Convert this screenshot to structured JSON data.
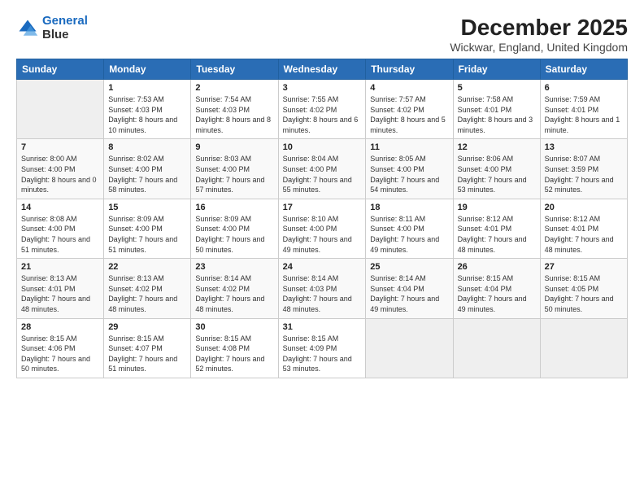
{
  "header": {
    "logo_line1": "General",
    "logo_line2": "Blue",
    "title": "December 2025",
    "subtitle": "Wickwar, England, United Kingdom"
  },
  "columns": [
    "Sunday",
    "Monday",
    "Tuesday",
    "Wednesday",
    "Thursday",
    "Friday",
    "Saturday"
  ],
  "weeks": [
    [
      {
        "day": "",
        "empty": true
      },
      {
        "day": "1",
        "sunrise": "Sunrise: 7:53 AM",
        "sunset": "Sunset: 4:03 PM",
        "daylight": "Daylight: 8 hours and 10 minutes."
      },
      {
        "day": "2",
        "sunrise": "Sunrise: 7:54 AM",
        "sunset": "Sunset: 4:03 PM",
        "daylight": "Daylight: 8 hours and 8 minutes."
      },
      {
        "day": "3",
        "sunrise": "Sunrise: 7:55 AM",
        "sunset": "Sunset: 4:02 PM",
        "daylight": "Daylight: 8 hours and 6 minutes."
      },
      {
        "day": "4",
        "sunrise": "Sunrise: 7:57 AM",
        "sunset": "Sunset: 4:02 PM",
        "daylight": "Daylight: 8 hours and 5 minutes."
      },
      {
        "day": "5",
        "sunrise": "Sunrise: 7:58 AM",
        "sunset": "Sunset: 4:01 PM",
        "daylight": "Daylight: 8 hours and 3 minutes."
      },
      {
        "day": "6",
        "sunrise": "Sunrise: 7:59 AM",
        "sunset": "Sunset: 4:01 PM",
        "daylight": "Daylight: 8 hours and 1 minute."
      }
    ],
    [
      {
        "day": "7",
        "sunrise": "Sunrise: 8:00 AM",
        "sunset": "Sunset: 4:00 PM",
        "daylight": "Daylight: 8 hours and 0 minutes."
      },
      {
        "day": "8",
        "sunrise": "Sunrise: 8:02 AM",
        "sunset": "Sunset: 4:00 PM",
        "daylight": "Daylight: 7 hours and 58 minutes."
      },
      {
        "day": "9",
        "sunrise": "Sunrise: 8:03 AM",
        "sunset": "Sunset: 4:00 PM",
        "daylight": "Daylight: 7 hours and 57 minutes."
      },
      {
        "day": "10",
        "sunrise": "Sunrise: 8:04 AM",
        "sunset": "Sunset: 4:00 PM",
        "daylight": "Daylight: 7 hours and 55 minutes."
      },
      {
        "day": "11",
        "sunrise": "Sunrise: 8:05 AM",
        "sunset": "Sunset: 4:00 PM",
        "daylight": "Daylight: 7 hours and 54 minutes."
      },
      {
        "day": "12",
        "sunrise": "Sunrise: 8:06 AM",
        "sunset": "Sunset: 4:00 PM",
        "daylight": "Daylight: 7 hours and 53 minutes."
      },
      {
        "day": "13",
        "sunrise": "Sunrise: 8:07 AM",
        "sunset": "Sunset: 3:59 PM",
        "daylight": "Daylight: 7 hours and 52 minutes."
      }
    ],
    [
      {
        "day": "14",
        "sunrise": "Sunrise: 8:08 AM",
        "sunset": "Sunset: 4:00 PM",
        "daylight": "Daylight: 7 hours and 51 minutes."
      },
      {
        "day": "15",
        "sunrise": "Sunrise: 8:09 AM",
        "sunset": "Sunset: 4:00 PM",
        "daylight": "Daylight: 7 hours and 51 minutes."
      },
      {
        "day": "16",
        "sunrise": "Sunrise: 8:09 AM",
        "sunset": "Sunset: 4:00 PM",
        "daylight": "Daylight: 7 hours and 50 minutes."
      },
      {
        "day": "17",
        "sunrise": "Sunrise: 8:10 AM",
        "sunset": "Sunset: 4:00 PM",
        "daylight": "Daylight: 7 hours and 49 minutes."
      },
      {
        "day": "18",
        "sunrise": "Sunrise: 8:11 AM",
        "sunset": "Sunset: 4:00 PM",
        "daylight": "Daylight: 7 hours and 49 minutes."
      },
      {
        "day": "19",
        "sunrise": "Sunrise: 8:12 AM",
        "sunset": "Sunset: 4:01 PM",
        "daylight": "Daylight: 7 hours and 48 minutes."
      },
      {
        "day": "20",
        "sunrise": "Sunrise: 8:12 AM",
        "sunset": "Sunset: 4:01 PM",
        "daylight": "Daylight: 7 hours and 48 minutes."
      }
    ],
    [
      {
        "day": "21",
        "sunrise": "Sunrise: 8:13 AM",
        "sunset": "Sunset: 4:01 PM",
        "daylight": "Daylight: 7 hours and 48 minutes."
      },
      {
        "day": "22",
        "sunrise": "Sunrise: 8:13 AM",
        "sunset": "Sunset: 4:02 PM",
        "daylight": "Daylight: 7 hours and 48 minutes."
      },
      {
        "day": "23",
        "sunrise": "Sunrise: 8:14 AM",
        "sunset": "Sunset: 4:02 PM",
        "daylight": "Daylight: 7 hours and 48 minutes."
      },
      {
        "day": "24",
        "sunrise": "Sunrise: 8:14 AM",
        "sunset": "Sunset: 4:03 PM",
        "daylight": "Daylight: 7 hours and 48 minutes."
      },
      {
        "day": "25",
        "sunrise": "Sunrise: 8:14 AM",
        "sunset": "Sunset: 4:04 PM",
        "daylight": "Daylight: 7 hours and 49 minutes."
      },
      {
        "day": "26",
        "sunrise": "Sunrise: 8:15 AM",
        "sunset": "Sunset: 4:04 PM",
        "daylight": "Daylight: 7 hours and 49 minutes."
      },
      {
        "day": "27",
        "sunrise": "Sunrise: 8:15 AM",
        "sunset": "Sunset: 4:05 PM",
        "daylight": "Daylight: 7 hours and 50 minutes."
      }
    ],
    [
      {
        "day": "28",
        "sunrise": "Sunrise: 8:15 AM",
        "sunset": "Sunset: 4:06 PM",
        "daylight": "Daylight: 7 hours and 50 minutes."
      },
      {
        "day": "29",
        "sunrise": "Sunrise: 8:15 AM",
        "sunset": "Sunset: 4:07 PM",
        "daylight": "Daylight: 7 hours and 51 minutes."
      },
      {
        "day": "30",
        "sunrise": "Sunrise: 8:15 AM",
        "sunset": "Sunset: 4:08 PM",
        "daylight": "Daylight: 7 hours and 52 minutes."
      },
      {
        "day": "31",
        "sunrise": "Sunrise: 8:15 AM",
        "sunset": "Sunset: 4:09 PM",
        "daylight": "Daylight: 7 hours and 53 minutes."
      },
      {
        "day": "",
        "empty": true
      },
      {
        "day": "",
        "empty": true
      },
      {
        "day": "",
        "empty": true
      }
    ]
  ]
}
